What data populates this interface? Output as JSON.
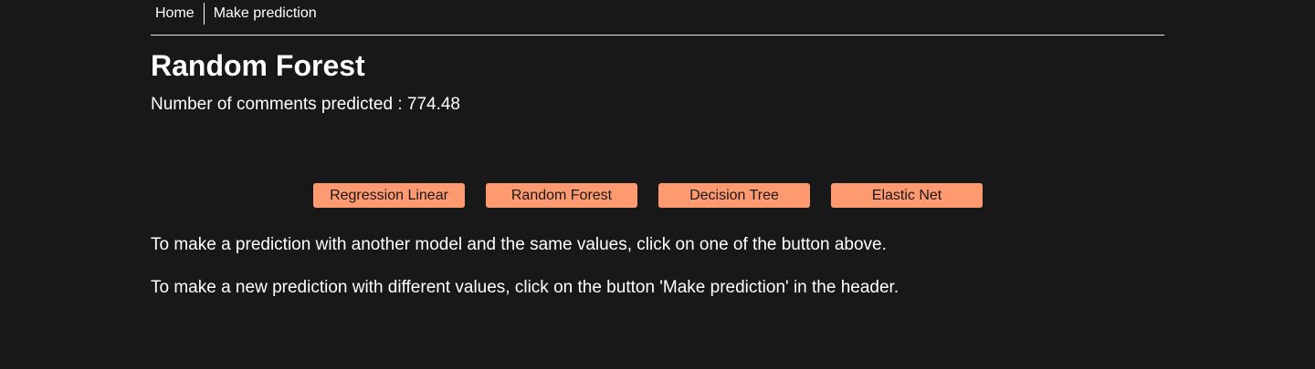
{
  "nav": {
    "home": "Home",
    "make_prediction": "Make prediction"
  },
  "page": {
    "title": "Random Forest",
    "result_label": "Number of comments predicted : ",
    "result_value": "774.48"
  },
  "models": {
    "buttons": [
      "Regression Linear",
      "Random Forest",
      "Decision Tree",
      "Elastic Net"
    ]
  },
  "info": {
    "line1": "To make a prediction with another model and the same values, click on one of the button above.",
    "line2": "To make a new prediction with different values, click on the button 'Make prediction' in the header."
  },
  "colors": {
    "background": "#181818",
    "button": "#ff9a70",
    "text": "#ffffff"
  }
}
